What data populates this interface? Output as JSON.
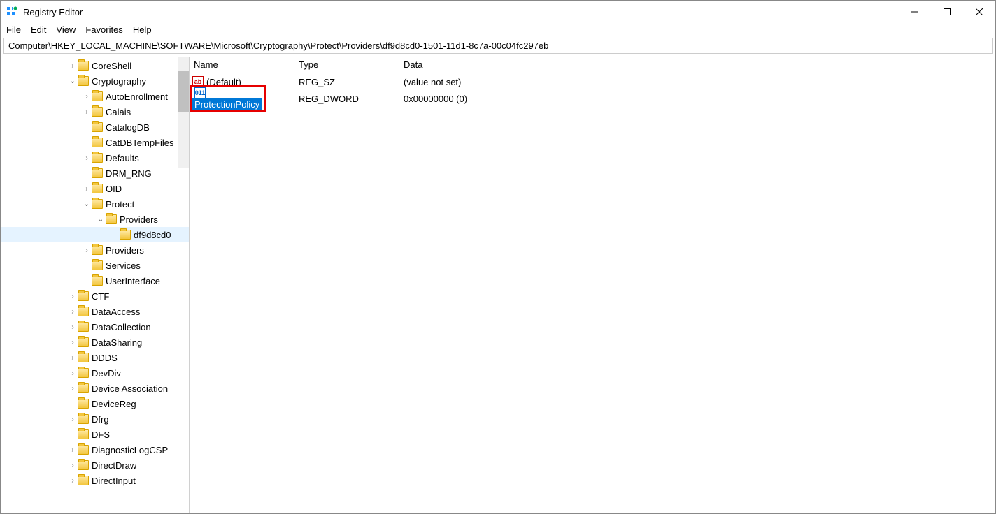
{
  "window": {
    "title": "Registry Editor"
  },
  "menu": {
    "file": "File",
    "edit": "Edit",
    "view": "View",
    "favorites": "Favorites",
    "help": "Help"
  },
  "address": "Computer\\HKEY_LOCAL_MACHINE\\SOFTWARE\\Microsoft\\Cryptography\\Protect\\Providers\\df9d8cd0-1501-11d1-8c7a-00c04fc297eb",
  "tree": {
    "items": [
      {
        "indent": 96,
        "chev": "closed",
        "label": "CoreShell"
      },
      {
        "indent": 96,
        "chev": "open",
        "label": "Cryptography"
      },
      {
        "indent": 116,
        "chev": "closed",
        "label": "AutoEnrollment"
      },
      {
        "indent": 116,
        "chev": "closed",
        "label": "Calais"
      },
      {
        "indent": 116,
        "chev": "none",
        "label": "CatalogDB"
      },
      {
        "indent": 116,
        "chev": "none",
        "label": "CatDBTempFiles"
      },
      {
        "indent": 116,
        "chev": "closed",
        "label": "Defaults"
      },
      {
        "indent": 116,
        "chev": "none",
        "label": "DRM_RNG"
      },
      {
        "indent": 116,
        "chev": "closed",
        "label": "OID"
      },
      {
        "indent": 116,
        "chev": "open",
        "label": "Protect"
      },
      {
        "indent": 136,
        "chev": "open",
        "label": "Providers"
      },
      {
        "indent": 156,
        "chev": "none",
        "label": "df9d8cd0",
        "selected": true
      },
      {
        "indent": 116,
        "chev": "closed",
        "label": "Providers"
      },
      {
        "indent": 116,
        "chev": "none",
        "label": "Services"
      },
      {
        "indent": 116,
        "chev": "none",
        "label": "UserInterface"
      },
      {
        "indent": 96,
        "chev": "closed",
        "label": "CTF"
      },
      {
        "indent": 96,
        "chev": "closed",
        "label": "DataAccess"
      },
      {
        "indent": 96,
        "chev": "closed",
        "label": "DataCollection"
      },
      {
        "indent": 96,
        "chev": "closed",
        "label": "DataSharing"
      },
      {
        "indent": 96,
        "chev": "closed",
        "label": "DDDS"
      },
      {
        "indent": 96,
        "chev": "closed",
        "label": "DevDiv"
      },
      {
        "indent": 96,
        "chev": "closed",
        "label": "Device Association"
      },
      {
        "indent": 96,
        "chev": "none",
        "label": "DeviceReg"
      },
      {
        "indent": 96,
        "chev": "closed",
        "label": "Dfrg"
      },
      {
        "indent": 96,
        "chev": "none",
        "label": "DFS"
      },
      {
        "indent": 96,
        "chev": "closed",
        "label": "DiagnosticLogCSP"
      },
      {
        "indent": 96,
        "chev": "closed",
        "label": "DirectDraw"
      },
      {
        "indent": 96,
        "chev": "closed",
        "label": "DirectInput"
      }
    ]
  },
  "columns": {
    "name": "Name",
    "type": "Type",
    "data": "Data"
  },
  "values": [
    {
      "icon": "str",
      "name": "(Default)",
      "type": "REG_SZ",
      "data": "(value not set)",
      "highlighted": false
    },
    {
      "icon": "bin",
      "name": "ProtectionPolicy",
      "type": "REG_DWORD",
      "data": "0x00000000 (0)",
      "highlighted": true
    }
  ]
}
